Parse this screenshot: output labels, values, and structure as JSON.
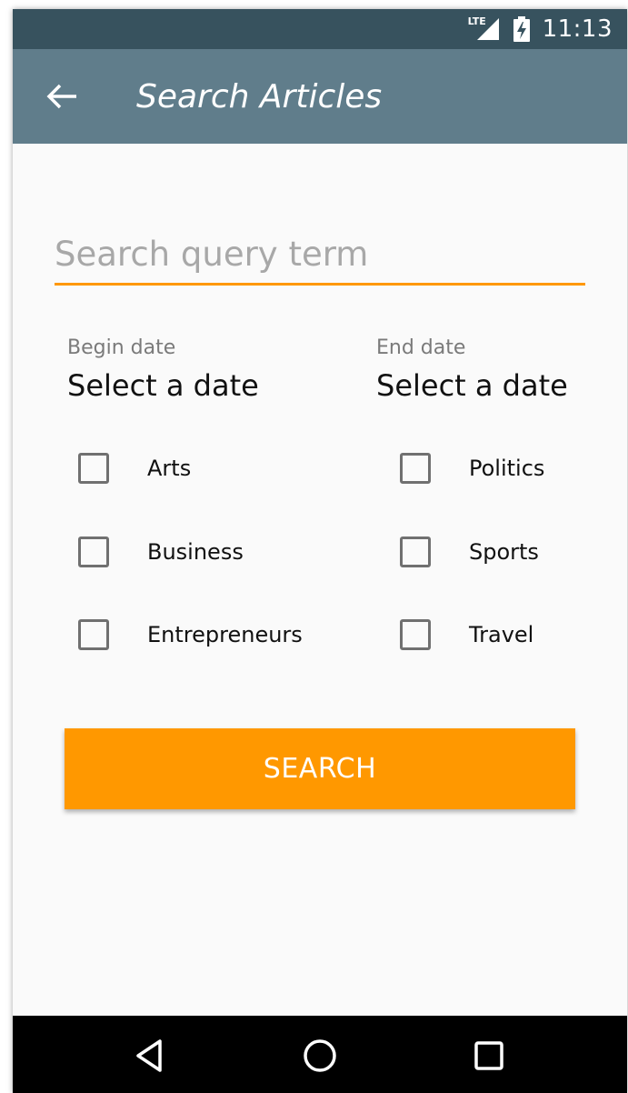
{
  "status_bar": {
    "network": "LTE",
    "time": "11:13",
    "icons": [
      "lte-signal-icon",
      "battery-charging-icon"
    ]
  },
  "app_bar": {
    "back_icon": "arrow-left-icon",
    "title": "Search Articles"
  },
  "search": {
    "value": "",
    "placeholder": "Search query term",
    "accent_color": "#ff9800"
  },
  "dates": {
    "begin": {
      "label": "Begin date",
      "value": "Select a date"
    },
    "end": {
      "label": "End date",
      "value": "Select a date"
    }
  },
  "categories": [
    {
      "label": "Arts",
      "checked": false
    },
    {
      "label": "Business",
      "checked": false
    },
    {
      "label": "Entrepreneurs",
      "checked": false
    },
    {
      "label": "Politics",
      "checked": false
    },
    {
      "label": "Sports",
      "checked": false
    },
    {
      "label": "Travel",
      "checked": false
    }
  ],
  "search_button": {
    "label": "SEARCH",
    "color": "#ff9800"
  },
  "nav_bar": {
    "icons": [
      "back-triangle-icon",
      "home-circle-icon",
      "recents-square-icon"
    ]
  },
  "colors": {
    "status_bar": "#37525e",
    "app_bar": "#607d8b",
    "background": "#fafafa"
  }
}
